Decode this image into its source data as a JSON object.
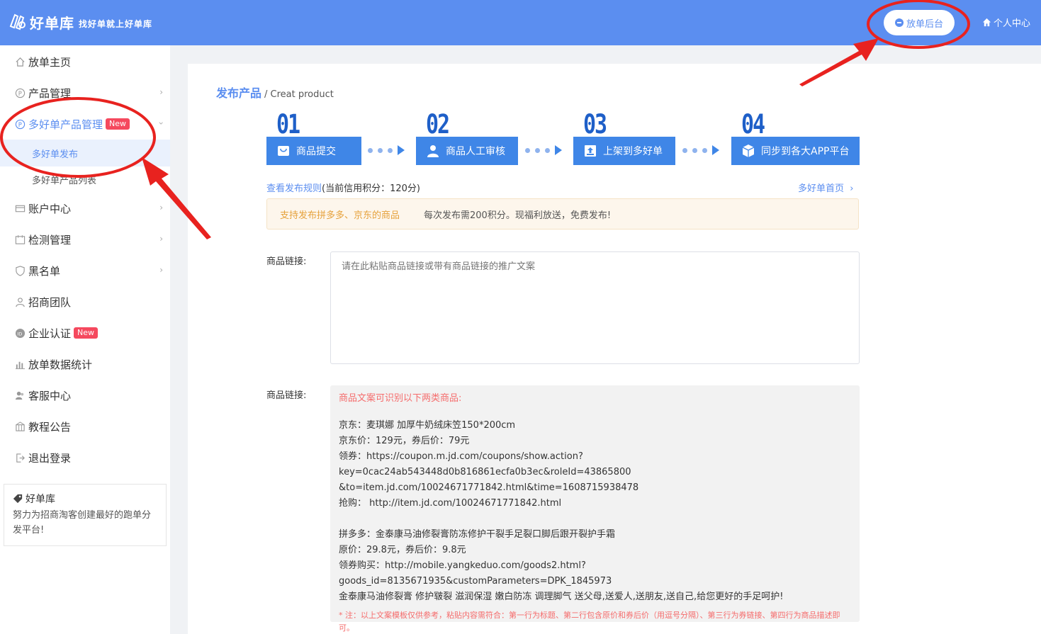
{
  "header": {
    "brand": "好单库",
    "slogan": "找好单就上好单库",
    "backend_button": "放单后台",
    "personal_center": "个人中心"
  },
  "sidebar": {
    "items": [
      {
        "label": "放单主页"
      },
      {
        "label": "产品管理"
      },
      {
        "label": "多好单产品管理",
        "badge": "New"
      },
      {
        "label": "账户中心"
      },
      {
        "label": "检测管理"
      },
      {
        "label": "黑名单"
      },
      {
        "label": "招商团队"
      },
      {
        "label": "企业认证",
        "badge": "New"
      },
      {
        "label": "放单数据统计"
      },
      {
        "label": "客服中心"
      },
      {
        "label": "教程公告"
      },
      {
        "label": "退出登录"
      }
    ],
    "sub_items": [
      {
        "label": "多好单发布"
      },
      {
        "label": "多好单产品列表"
      }
    ],
    "card": {
      "title": "好单库",
      "desc": "努力为招商淘客创建最好的跑单分发平台!"
    }
  },
  "main": {
    "crumb_title": "发布产品",
    "crumb_sub": "/ Creat product",
    "steps": [
      {
        "num": "01",
        "label": "商品提交"
      },
      {
        "num": "02",
        "label": "商品人工审核"
      },
      {
        "num": "03",
        "label": "上架到多好单"
      },
      {
        "num": "04",
        "label": "同步到各大APP平台"
      }
    ],
    "rules_link": "查看发布规则",
    "credit_text": "(当前信用积分：120分)",
    "home_link": "多好单首页",
    "notice_left": "支持发布拼多多、京东的商品",
    "notice_right": "每次发布需200积分。现福利放送，免费发布!",
    "link_label": "商品链接:",
    "link_placeholder": "请在此粘贴商品链接或带有商品链接的推广文案",
    "example_label": "商品链接:",
    "example": {
      "heading": "商品文案可识别以下两类商品:",
      "jd": [
        "京东：麦琪娜 加厚牛奶绒床笠150*200cm",
        "京东价：129元，券后价：79元",
        "领券：https://coupon.m.jd.com/coupons/show.action?key=0cac24ab543448d0b816861ecfa0b3ec&roleId=43865800",
        "&to=item.jd.com/10024671771842.html&time=1608715938478",
        "抢购： http://item.jd.com/10024671771842.html"
      ],
      "pdd": [
        "拼多多：金泰康马油修裂膏防冻修护干裂手足裂口脚后跟开裂护手霜",
        "原价：29.8元，券后价：9.8元",
        "领券购买：http://mobile.yangkeduo.com/goods2.html?goods_id=8135671935&customParameters=DPK_1845973",
        "金泰康马油修裂膏 修护皲裂 滋润保湿 嫩白防冻 调理脚气 送父母,送爱人,送朋友,送自己,给您更好的手足呵护!"
      ],
      "note": "* 注：以上文案模板仅供参考，粘贴内容需符合：第一行为标题、第二行包含原价和券后价（用逗号分隔）、第三行为券链接、第四行为商品描述即可。"
    }
  },
  "colors": {
    "primary": "#5b8ef0",
    "step_blue": "#3f86e7",
    "annotation_red": "#e8221f",
    "badge_red": "#f5495e"
  }
}
